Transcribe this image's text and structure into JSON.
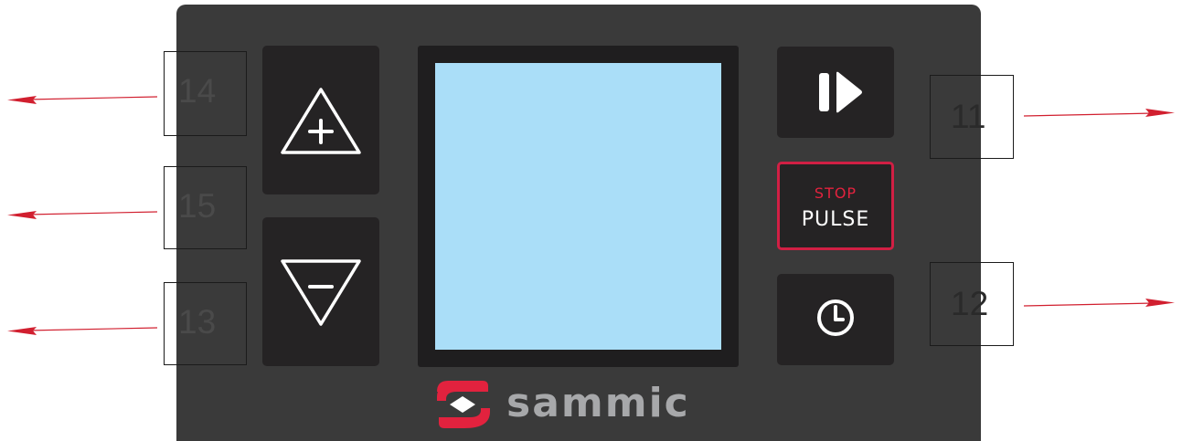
{
  "panel": {
    "stop_label": "STOP",
    "pulse_label": "PULSE",
    "brand_name": "sammic",
    "icons": {
      "increase": "plus-triangle-icon",
      "decrease": "minus-triangle-icon",
      "start": "play-icon",
      "timer": "clock-icon",
      "logo": "sammic-logo-icon"
    },
    "colors": {
      "panel": "#3a3a3a",
      "key": "#252324",
      "screen": "#aadef8",
      "stop_accent": "#e2223e",
      "logo_red": "#e2223e",
      "brand_text": "#a7a8aa",
      "callout_arrow": "#d11f2f"
    }
  },
  "callouts": {
    "increase": "14",
    "pulse_decrease": "15",
    "decrease": "13",
    "start": "11",
    "timer": "12"
  }
}
